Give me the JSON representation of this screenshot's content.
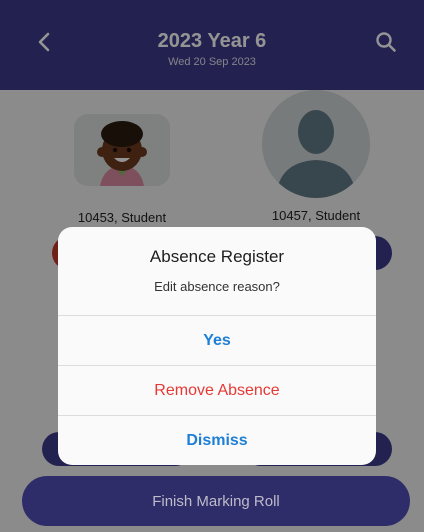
{
  "header": {
    "title": "2023 Year 6",
    "date": "Wed 20 Sep 2023",
    "back_icon": "chevron-left-icon",
    "search_icon": "search-icon"
  },
  "students": [
    {
      "label": "10453, Student",
      "avatar": "child-avatar"
    },
    {
      "label": "10457, Student",
      "avatar": "silhouette-avatar"
    }
  ],
  "dialog": {
    "title": "Absence Register",
    "message": "Edit absence reason?",
    "buttons": {
      "yes": "Yes",
      "remove": "Remove Absence",
      "dismiss": "Dismiss"
    }
  },
  "footer": {
    "finish_label": "Finish Marking Roll"
  },
  "colors": {
    "header_bg": "#3d3a8a",
    "accent_blue": "#1e7fd6",
    "danger_red": "#e53935"
  }
}
